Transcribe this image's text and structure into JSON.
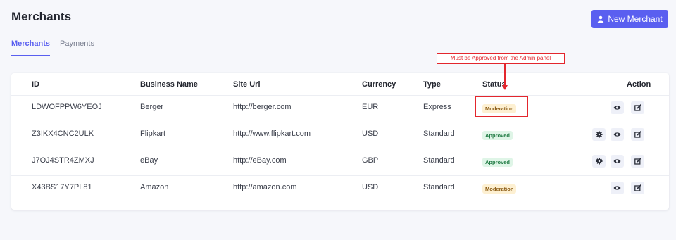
{
  "header": {
    "title": "Merchants",
    "new_button": "New Merchant"
  },
  "tabs": [
    {
      "label": "Merchants",
      "active": true
    },
    {
      "label": "Payments",
      "active": false
    }
  ],
  "table": {
    "headers": [
      "ID",
      "Business Name",
      "Site Url",
      "Currency",
      "Type",
      "Status",
      "Action"
    ],
    "rows": [
      {
        "id": "LDWOFPPW6YEOJ",
        "name": "Berger",
        "url": "http://berger.com",
        "currency": "EUR",
        "type": "Express",
        "status": "Moderation"
      },
      {
        "id": "Z3IKX4CNC2ULK",
        "name": "Flipkart",
        "url": "http://www.flipkart.com",
        "currency": "USD",
        "type": "Standard",
        "status": "Approved"
      },
      {
        "id": "J7OJ4STR4ZMXJ",
        "name": "eBay",
        "url": "http://eBay.com",
        "currency": "GBP",
        "type": "Standard",
        "status": "Approved"
      },
      {
        "id": "X43BS17Y7PL81",
        "name": "Amazon",
        "url": "http://amazon.com",
        "currency": "USD",
        "type": "Standard",
        "status": "Moderation"
      }
    ]
  },
  "annotation": {
    "text": "Must be Approved from the Admin panel"
  },
  "colors": {
    "accent": "#5a5ff0",
    "annotation": "#e3262d",
    "moderation_bg": "#fdf0d2",
    "approved_bg": "#dff5e7"
  },
  "icons": {
    "new_button": "user-icon",
    "settings": "gear-icon",
    "view": "eye-icon",
    "edit": "edit-icon"
  }
}
